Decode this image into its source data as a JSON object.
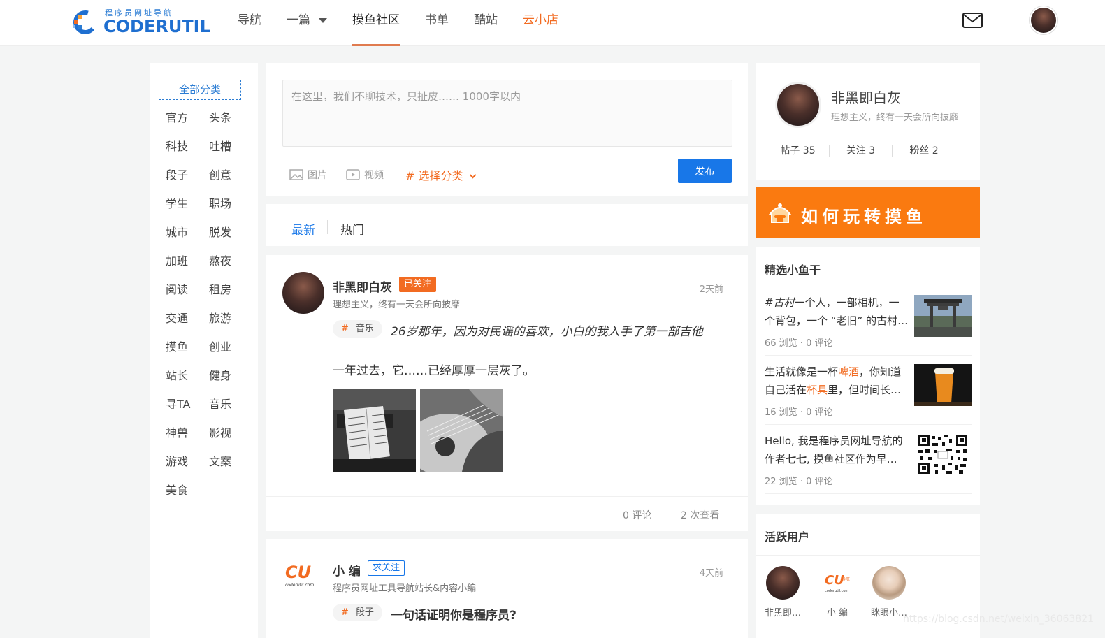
{
  "header": {
    "logo_sub": "程序员网址导航",
    "logo_main": "CODERUTIL",
    "nav": [
      "导航",
      "一篇",
      "摸鱼社区",
      "书单",
      "酷站",
      "云小店"
    ]
  },
  "sidebar": {
    "all": "全部分类",
    "categories": [
      "官方",
      "头条",
      "科技",
      "吐槽",
      "段子",
      "创意",
      "学生",
      "职场",
      "城市",
      "脱发",
      "加班",
      "熬夜",
      "阅读",
      "租房",
      "交通",
      "旅游",
      "摸鱼",
      "创业",
      "站长",
      "健身",
      "寻TA",
      "音乐",
      "神兽",
      "影视",
      "游戏",
      "文案",
      "美食"
    ]
  },
  "composer": {
    "placeholder": "在这里，我们不聊技术，只扯皮…… 1000字以内",
    "image_label": "图片",
    "video_label": "视频",
    "category_label": "# 选择分类",
    "publish_label": "发布"
  },
  "tabs": {
    "latest": "最新",
    "hot": "热门"
  },
  "posts": [
    {
      "author": "非黑即白灰",
      "follow": "已关注",
      "time": "2天前",
      "bio": "理想主义，终有一天会所向披靡",
      "tag_hash": "#",
      "tag": "音乐",
      "title": "26岁那年，因为对民谣的喜欢，小白的我入手了第一部吉他",
      "body": "一年过去，它……已经厚厚一层灰了。",
      "comments": "0 评论",
      "views": "2 次查看"
    },
    {
      "author": "小 编",
      "follow": "求关注",
      "time": "4天前",
      "bio": "程序员网址工具导航站长&内容小编",
      "tag_hash": "#",
      "tag": "段子",
      "title": "一句话证明你是程序员?"
    }
  ],
  "profile": {
    "name": "非黑即白灰",
    "bio": "理想主义，终有一天会所向披靡",
    "posts": "帖子 35",
    "following": "关注 3",
    "followers": "粉丝 2"
  },
  "banner": {
    "text": "如何玩转摸鱼"
  },
  "featured": {
    "title": "精选小鱼干",
    "items": [
      {
        "text_a": "#古村",
        "text_b": "一个人，一部相机，一个背包，一个 “老旧” 的古村…",
        "meta": "66 浏览 · 0 评论"
      },
      {
        "text_a": "生活就像是一杯",
        "hl1": "啤酒",
        "text_b": "，你知道自己活在",
        "hl2": "杯具",
        "text_c": "里，但时间长…",
        "meta": "16 浏览 · 0 评论"
      },
      {
        "text_a": "Hello, 我是程序员网址导航的作者",
        "bold": "七七",
        "text_b": ", 摸鱼社区作为早…",
        "meta": "22 浏览 · 0 评论"
      }
    ]
  },
  "active_users": {
    "title": "活跃用户",
    "users": [
      "非黑即…",
      "小 编",
      "眯眼小…"
    ]
  },
  "logo_cu": {
    "main": "CU",
    "small": "coderutil.com",
    "tag": "导航"
  },
  "watermark": "https://blog.csdn.net/weixin_36063821",
  "colors": {
    "accent": "#1877e8",
    "orange": "#f26b21",
    "banner": "#fa7a10"
  }
}
